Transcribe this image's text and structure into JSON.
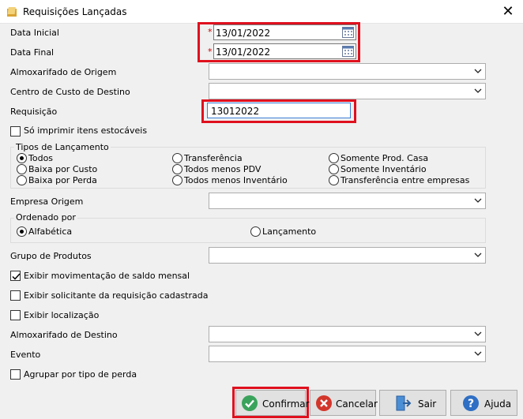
{
  "window": {
    "title": "Requisições Lançadas",
    "close_glyph": "✕"
  },
  "form": {
    "data_inicial": {
      "label": "Data Inicial",
      "value": "13/01/2022",
      "required_mark": "*"
    },
    "data_final": {
      "label": "Data Final",
      "value": "13/01/2022",
      "required_mark": "*"
    },
    "almox_origem": {
      "label": "Almoxarifado de Origem",
      "value": ""
    },
    "centro_custo": {
      "label": "Centro de Custo de Destino",
      "value": ""
    },
    "requisicao": {
      "label": "Requisição",
      "value": "13012022"
    },
    "so_imprimir": {
      "label": "Só imprimir itens estocáveis",
      "checked": false
    },
    "tipos": {
      "title": "Tipos de Lançamento",
      "options": [
        {
          "label": "Todos",
          "selected": true
        },
        {
          "label": "Baixa por Custo",
          "selected": false
        },
        {
          "label": "Baixa por Perda",
          "selected": false
        },
        {
          "label": "Transferência",
          "selected": false
        },
        {
          "label": "Todos menos PDV",
          "selected": false
        },
        {
          "label": "Todos menos Inventário",
          "selected": false
        },
        {
          "label": "Somente Prod. Casa",
          "selected": false
        },
        {
          "label": "Somente Inventário",
          "selected": false
        },
        {
          "label": "Transferência entre empresas",
          "selected": false
        }
      ]
    },
    "empresa_origem": {
      "label": "Empresa Origem",
      "value": ""
    },
    "ordenado": {
      "title": "Ordenado por",
      "options": [
        {
          "label": "Alfabética",
          "selected": true
        },
        {
          "label": "Lançamento",
          "selected": false
        }
      ]
    },
    "grupo_produtos": {
      "label": "Grupo de Produtos",
      "value": ""
    },
    "exibir_mov": {
      "label": "Exibir movimentação de saldo mensal",
      "checked": true
    },
    "exibir_solicitante": {
      "label": "Exibir solicitante da requisição cadastrada",
      "checked": false
    },
    "exibir_localizacao": {
      "label": "Exibir localização",
      "checked": false
    },
    "almox_destino": {
      "label": "Almoxarifado de Destino",
      "value": ""
    },
    "evento": {
      "label": "Evento",
      "value": ""
    },
    "agrupar": {
      "label": "Agrupar por tipo de perda",
      "checked": false
    }
  },
  "buttons": {
    "confirmar": "Confirmar",
    "cancelar": "Cancelar",
    "sair": "Sair",
    "ajuda": "Ajuda"
  },
  "colors": {
    "highlight": "#e0101e",
    "required": "#d00000"
  },
  "icons": {
    "app": "folder-icon",
    "calendar": "calendar-icon",
    "confirm": "check-circle-icon",
    "cancel": "x-circle-icon",
    "exit": "exit-door-icon",
    "help": "question-circle-icon"
  }
}
